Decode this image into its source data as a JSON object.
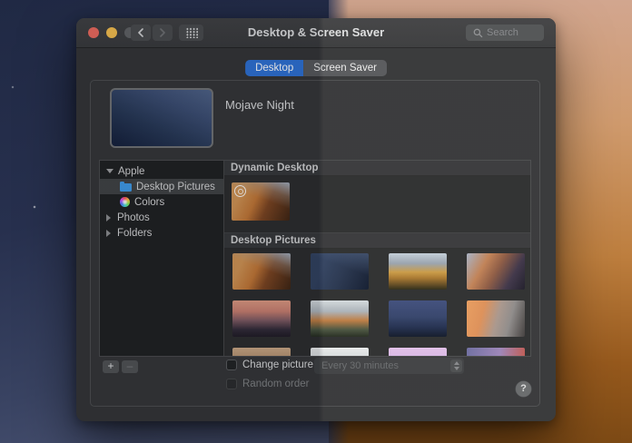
{
  "window": {
    "title": "Desktop & Screen Saver"
  },
  "titlebar": {
    "search_placeholder": "Search"
  },
  "tabs": {
    "desktop": "Desktop",
    "screensaver": "Screen Saver"
  },
  "colors": {
    "accent_blue": "#2e71d4",
    "traffic_red": "#ec6a5e",
    "traffic_yellow": "#f5bf4f",
    "traffic_inactive": "#606264"
  },
  "preview": {
    "label": "Mojave Night",
    "style": "background:linear-gradient(205deg,#4f6388 0%,#3c4e73 30%,#273856 62%,#141f3a 100%)"
  },
  "sidebar": {
    "items": [
      {
        "label": "Apple"
      },
      {
        "label": "Desktop Pictures"
      },
      {
        "label": "Colors"
      },
      {
        "label": "Photos"
      },
      {
        "label": "Folders"
      }
    ]
  },
  "sections": {
    "dynamic": {
      "header": "Dynamic Desktop",
      "thumb": {
        "alt": "mojave-dynamic",
        "style": "background:linear-gradient(200deg,rgba(165,178,195,.95) 0%,rgba(160,160,160,.35) 25%,rgba(0,0,0,0) 45%),linear-gradient(115deg,#d19454 18%,#c27736 42%,#7c4521 62%,#3f2513 100%)"
      }
    },
    "pictures": {
      "header": "Desktop Pictures",
      "items": [
        {
          "alt": "mojave-day",
          "style": "background:linear-gradient(200deg,rgba(165,178,195,.95) 0%,rgba(160,160,160,.35) 25%,rgba(0,0,0,0) 45%),linear-gradient(115deg,#d19454 18%,#c27736 42%,#7c4521 62%,#3f2513 100%)"
        },
        {
          "alt": "mojave-night",
          "style": "background:linear-gradient(200deg,rgba(90,110,145,.5) 0%,rgba(0,0,0,0) 40%),linear-gradient(115deg,#31415f 25%,#26344e 55%,#101a2e 100%)"
        },
        {
          "alt": "high-sierra",
          "style": "background:linear-gradient(180deg,#c2cdd8 0%,#98a2ad 28%,#c99a44 52%,#a8772e 68%,#2e2a17 100%)"
        },
        {
          "alt": "sierra-peaks",
          "style": "background:linear-gradient(120deg,#a6b1c4 0%,#c08054 30%,#8d5a42 50%,#3c3347 75%,#1d1b28 100%)"
        },
        {
          "alt": "sierra-clouds",
          "style": "background:linear-gradient(180deg,#dd9a82 0%,#c97f70 30%,#7e5a62 55%,#322b38 80%,#201c26 100%)"
        },
        {
          "alt": "el-capitan",
          "style": "background:linear-gradient(180deg,#d3d9dc 0%,#aab2b9 30%,#bd7c42 55%,#49543f 80%,#252c20 100%)"
        },
        {
          "alt": "yosemite-night",
          "style": "background:linear-gradient(180deg,#3e4d7c 0%,#33426a 45%,#1f2c4c 75%,#101828 100%)"
        },
        {
          "alt": "half-dome",
          "style": "background:linear-gradient(105deg,#e79c5e 0%,#dd8f57 28%,#a8968c 52%,#8d8a89 72%,#403c3b 100%)"
        },
        {
          "alt": "desert-ridge",
          "style": "background:linear-gradient(180deg,#cba886 0%,#7e5a35 100%)"
        },
        {
          "alt": "snowy-peak",
          "style": "background:linear-gradient(180deg,#e8eaeb 0%,#aab1b5 100%)"
        },
        {
          "alt": "lavender-sky",
          "style": "background:linear-gradient(180deg,#e2c0e8 0%,#b99ddd 100%)"
        },
        {
          "alt": "aurora-sky",
          "style": "background:linear-gradient(95deg,#6d6da0 0%,#9b84b8 55%,#c2564a 100%)"
        }
      ]
    }
  },
  "controls": {
    "add_label": "+",
    "remove_label": "–",
    "change_picture_label": "Change picture:",
    "interval_value": "Every 30 minutes",
    "random_order_label": "Random order",
    "help_label": "?"
  }
}
